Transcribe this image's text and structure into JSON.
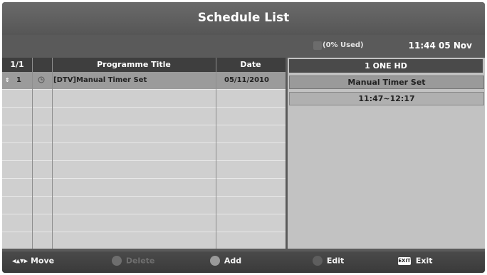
{
  "header": {
    "title": "Schedule List"
  },
  "status": {
    "usage": "(0% Used)",
    "clock": "11:44 05 Nov"
  },
  "table": {
    "page": "1/1",
    "columns": {
      "title": "Programme Title",
      "date": "Date"
    },
    "rows": [
      {
        "index": "1",
        "title": "[DTV]Manual Timer Set",
        "date": "05/11/2010"
      }
    ]
  },
  "detail": {
    "channel": "1 ONE HD",
    "name": "Manual Timer Set",
    "time": "11:47~12:17"
  },
  "footer": {
    "move": "Move",
    "delete": "Delete",
    "add": "Add",
    "edit": "Edit",
    "exit_badge": "EXIT",
    "exit": "Exit"
  },
  "colors": {
    "background": "#5a5a5a",
    "table": "#cfcfcf",
    "selected_row": "#9b9b9b"
  },
  "icons": [
    "move-arrows-icon",
    "red-button-icon",
    "green-button-icon",
    "yellow-button-icon",
    "exit-key-icon",
    "timer-clock-icon",
    "scroll-arrows-icon"
  ]
}
